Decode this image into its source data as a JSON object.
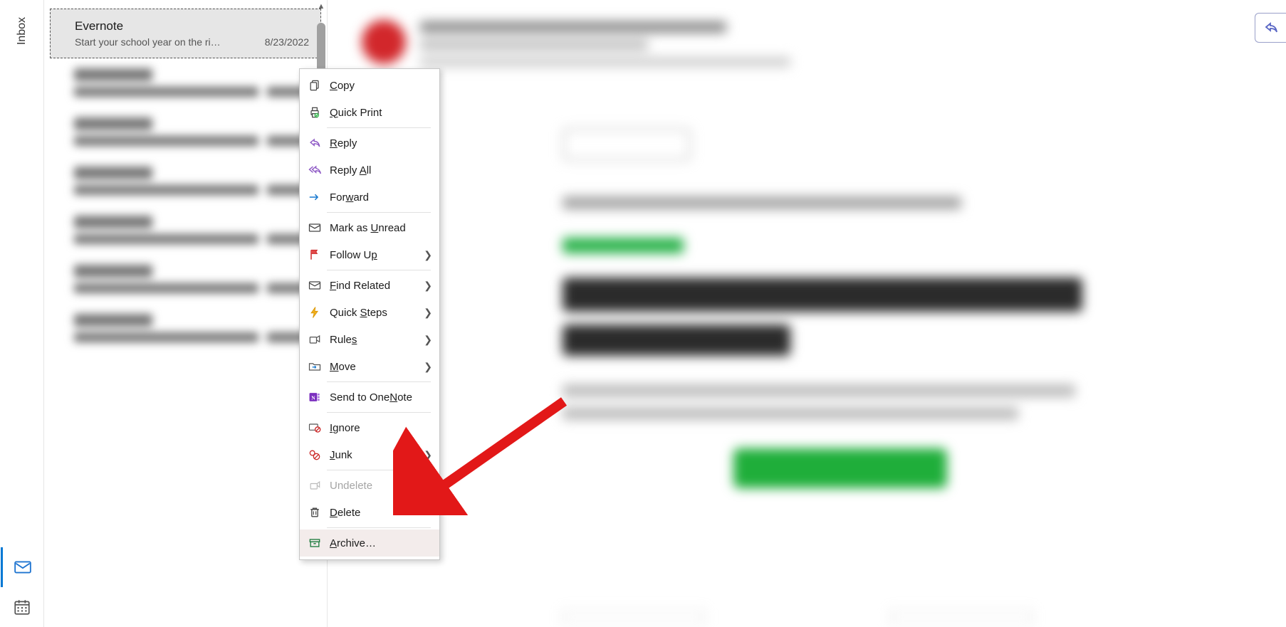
{
  "rail": {
    "inbox_label": "Inbox"
  },
  "list": {
    "messages": [
      {
        "from": "Evernote",
        "preview": "Start your school year on the ri…",
        "date": "8/23/2022",
        "selected": true
      }
    ]
  },
  "blurred_rows": 6,
  "context_menu": {
    "copy": "Copy",
    "quick_print": "Quick Print",
    "reply": "Reply",
    "reply_all": "Reply All",
    "forward": "Forward",
    "mark_unread": "Mark as Unread",
    "follow_up": "Follow Up",
    "find_related": "Find Related",
    "quick_steps": "Quick Steps",
    "rules": "Rules",
    "move": "Move",
    "onenote": "Send to OneNote",
    "ignore": "Ignore",
    "junk": "Junk",
    "undelete": "Undelete",
    "delete": "Delete",
    "archive": "Archive…"
  },
  "reply_button_tooltip": "Reply"
}
